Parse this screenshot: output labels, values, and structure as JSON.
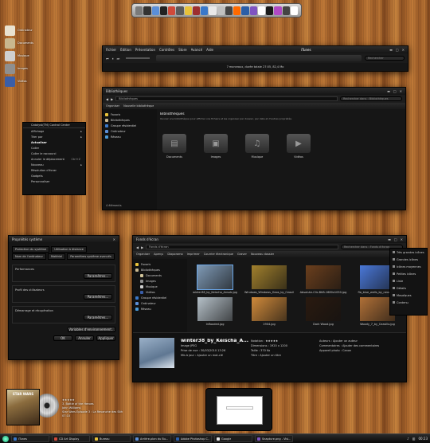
{
  "dock": {
    "icon_colors": [
      "#7a7a7a",
      "#333333",
      "#5b8fd8",
      "#222222",
      "#d04a3a",
      "#5b5b5b",
      "#e8c23a",
      "#9d2f2f",
      "#3a78c9",
      "#e9e9e9",
      "#c0c0c0",
      "#444444",
      "#ff6a00",
      "#2a5ea8",
      "#7f54c1",
      "#ffffff",
      "#1a1a1a",
      "#b04ac4",
      "#444444",
      "#ffffff"
    ]
  },
  "desktop_icons": [
    {
      "label": "Ordinateur",
      "color": "#e9e2d0"
    },
    {
      "label": "Documents",
      "color": "#c9b78e"
    },
    {
      "label": "Musique",
      "color": "#cfcfcf"
    },
    {
      "label": "Images",
      "color": "#8f8f8f"
    },
    {
      "label": "Vidéos",
      "color": "#3a5ea8"
    }
  ],
  "itunes": {
    "title": "iTunes",
    "menu": [
      "Fichier",
      "Édition",
      "Présentation",
      "Contrôles",
      "Store",
      "Avancé",
      "Aide"
    ],
    "status": "7 morceaux, durée totale 27:05, 82,4 Mo",
    "search_placeholder": "Rechercher"
  },
  "libraries_window": {
    "title": "Bibliothèques",
    "address": "Bibliothèques",
    "search_placeholder": "Rechercher dans : Bibliothèques",
    "toolbar": [
      "Organiser",
      "Nouvelle bibliothèque"
    ],
    "nav": [
      "Favoris",
      "Bibliothèques",
      "Groupe résidentiel",
      "Ordinateur",
      "Réseau"
    ],
    "header": "Bibliothèques",
    "subheader": "Ouvrez une bibliothèque pour afficher vos fichiers et les organiser par dossier, par date et d'autres propriétés.",
    "libraries": [
      "Documents",
      "Images",
      "Musique",
      "Vidéos"
    ],
    "footer": "4 éléments"
  },
  "context_menu": {
    "header": "Catalyst(TM) Control Center",
    "items": [
      "Affichage",
      "Trier par",
      "Actualiser",
      "Coller",
      "Coller le raccourci",
      "Annuler le déplacement",
      "Nouveau",
      "Résolution d'écran",
      "Gadgets",
      "Personnaliser"
    ],
    "shortcut": "Ctrl+Z"
  },
  "properties": {
    "title": "Propriétés système",
    "tabs": [
      "Protection du système",
      "Utilisation à distance",
      "Nom de l'ordinateur",
      "Matériel",
      "Paramètres système avancés"
    ],
    "sections": [
      "Performances",
      "Profil des utilisateurs",
      "Démarrage et récupération"
    ],
    "param_button": "Paramètres...",
    "env_button": "Variables d'environnement...",
    "ok": "OK",
    "cancel": "Annuler",
    "apply": "Appliquer"
  },
  "images_window": {
    "title": "Fonds d'écran",
    "address": "Fonds d'écran",
    "search_placeholder": "Rechercher dans : Fonds d'écran",
    "toolbar": [
      "Organiser",
      "Aperçu",
      "Diaporama",
      "Imprimer",
      "Courrier électronique",
      "Graver",
      "Nouveau dossier"
    ],
    "nav": [
      "Favoris",
      "Bibliothèques",
      "Documents",
      "Images",
      "Musique",
      "Vidéos",
      "Groupe résidentiel",
      "Ordinateur",
      "Réseau"
    ],
    "thumbs": [
      {
        "name": "winter38_by_Keischa_Ansub.jpg",
        "color": "#7f9ab6"
      },
      {
        "name": "Windows_Windows_Geos_by_Ceasillo.jpg",
        "color": "#a1802d"
      },
      {
        "name": "Absolute-Clic-BhB-1680x1050.jpg",
        "color": "#6b3f1d"
      },
      {
        "name": "fla_blue_wells_by_nexus.jpg",
        "color": "#4a78d8"
      },
      {
        "name": "Inflooded.jpg",
        "color": "#b6c1c9"
      },
      {
        "name": "1904.jpg",
        "color": "#d08a3b"
      },
      {
        "name": "Dark Wood.jpg",
        "color": "#2a1a10"
      },
      {
        "name": "Woody_7_by_Ceasillo.jpg",
        "color": "#b07037"
      }
    ],
    "detail": {
      "name": "winter38_by_Keischa_A...",
      "type": "Image JPEG",
      "date_taken": "Prise de vue : 30/03/2010 13:26",
      "date_modified": "Mis à jour : Ajouter un mot-clé",
      "rating_label": "Notation :",
      "stars": "★★★★★",
      "dimensions": "Dimensions : 1920 x 1200",
      "size": "Taille : 370 Ko",
      "title": "Titre : Ajouter un titre",
      "authors": "Auteurs : Ajouter un auteur",
      "comments": "Commentaires : Ajouter des commentaires",
      "camera": "Appareil photo : Canon"
    }
  },
  "side_menu": {
    "items": [
      "Très grandes icônes",
      "Grandes icônes",
      "Icônes moyennes",
      "Petites icônes",
      "Liste",
      "Détails",
      "Mosaïques",
      "Contenu"
    ]
  },
  "mini_player": {
    "cover_text": "STAR WARS",
    "rating": "★★★★★",
    "track": "3. Battle of the Heroes",
    "artist": "John Williams",
    "album": "Star Wars Episode 3 : La Revanche des Sith",
    "time": "07:10"
  },
  "taskbar": {
    "items": [
      {
        "label": "iTunes",
        "color": "#3a78c9"
      },
      {
        "label": "CD Art Display",
        "color": "#d04a3a"
      },
      {
        "label": "Bureau",
        "color": "#e8c23a"
      },
      {
        "label": "Arrière-plan du Bu...",
        "color": "#5b8fd8"
      },
      {
        "label": "Adobe Photoshop C...",
        "color": "#2a5ea8"
      },
      {
        "label": "Google",
        "color": "#e9e9e9"
      },
      {
        "label": "Snapture.png - Visi...",
        "color": "#7f54c1"
      }
    ],
    "clock": "00:23"
  }
}
